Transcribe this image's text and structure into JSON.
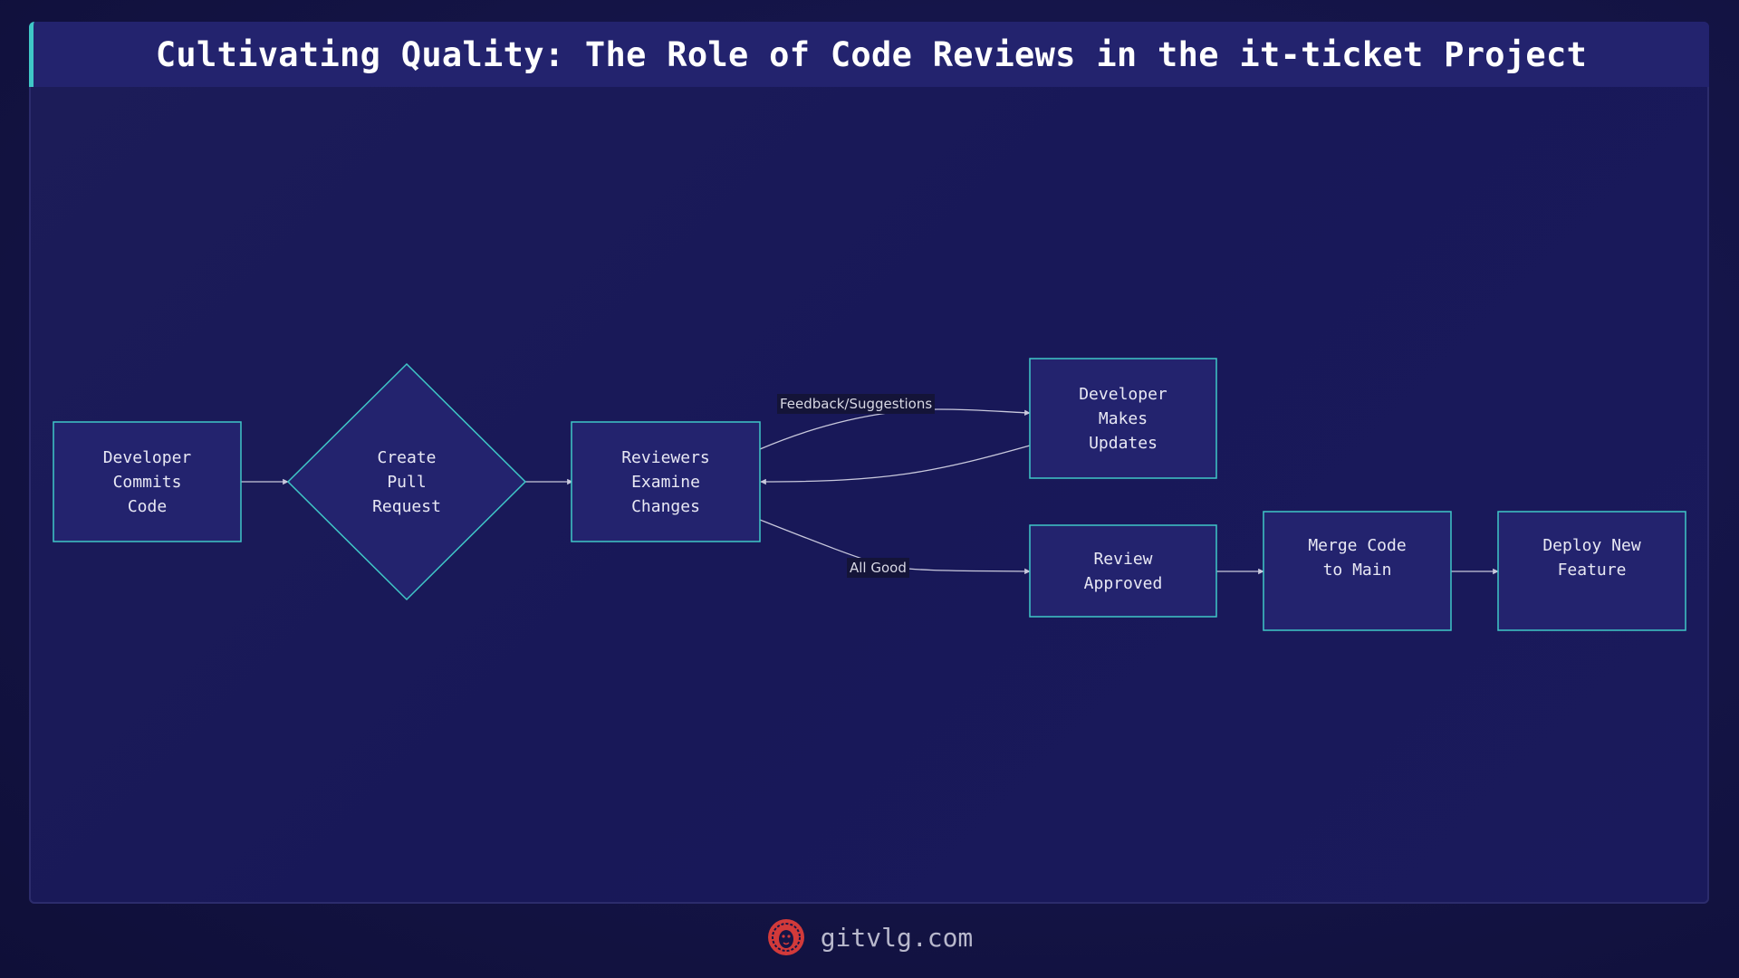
{
  "title": "Cultivating Quality: The Role of Code Reviews in the it-ticket Project",
  "nodes": {
    "commit": "Developer\nCommits\nCode",
    "pull_request": "Create\nPull\nRequest",
    "examine": "Reviewers\nExamine\nChanges",
    "updates": "Developer\nMakes\nUpdates",
    "approved": "Review\nApproved",
    "merge": "Merge Code\nto Main",
    "deploy": "Deploy New\nFeature"
  },
  "edges": {
    "feedback": "Feedback/Suggestions",
    "all_good": "All Good"
  },
  "footer": {
    "site": "gitvlg.com",
    "logo_icon": "lion-head-icon"
  },
  "colors": {
    "node_fill": "#23236e",
    "node_border": "#3fc7c7",
    "edge": "#c8c8dc",
    "accent": "#3fc7c7",
    "logo": "#d23a3a"
  }
}
